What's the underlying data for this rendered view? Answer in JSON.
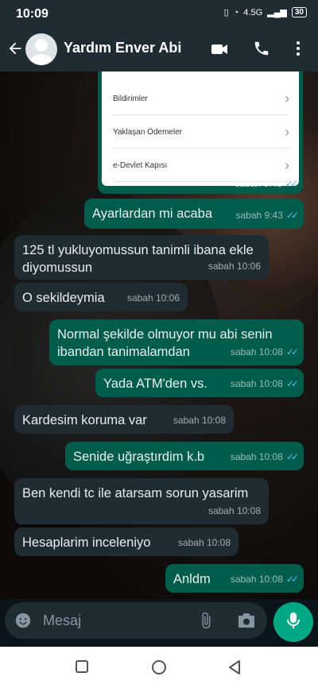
{
  "status": {
    "time": "10:09",
    "network": "4.5G",
    "battery": "30"
  },
  "header": {
    "contact_name": "Yardım Enver Abi"
  },
  "screenshot": {
    "items": [
      "Bildirimler",
      "Yaklaşan Ödemeler",
      "e-Devlet Kapısı"
    ],
    "time": "sabah 9:43"
  },
  "messages": [
    {
      "dir": "out",
      "text": "Ayarlardan mi acaba",
      "time": "sabah 9:43"
    },
    {
      "dir": "in",
      "text": "125 tl yukluyomussun tanimli ibana ekle diyomussun",
      "time": "sabah 10:06"
    },
    {
      "dir": "in",
      "text": "O sekildeymia",
      "time": "sabah 10:06"
    },
    {
      "dir": "out",
      "text": "Normal şekilde olmuyor mu abi senin ibandan tanimalamdan",
      "time": "sabah 10:08"
    },
    {
      "dir": "out",
      "text": "Yada ATM'den vs.",
      "time": "sabah 10:08"
    },
    {
      "dir": "in",
      "text": "Kardesim koruma var",
      "time": "sabah 10:08"
    },
    {
      "dir": "out",
      "text": "Senide uğraştırdim k.b",
      "time": "sabah 10:08"
    },
    {
      "dir": "in",
      "text": "Ben kendi tc ile atarsam sorun yasarim",
      "time": "sabah 10:08"
    },
    {
      "dir": "in",
      "text": "Hesaplarim inceleniyo",
      "time": "sabah 10:08"
    },
    {
      "dir": "out",
      "text": "Anldm",
      "time": "sabah 10:08"
    }
  ],
  "input": {
    "placeholder": "Mesaj"
  },
  "colors": {
    "incoming": "#1f2c34",
    "outgoing": "#005c4b",
    "accent": "#00a884",
    "read_ticks": "#53bdeb"
  }
}
